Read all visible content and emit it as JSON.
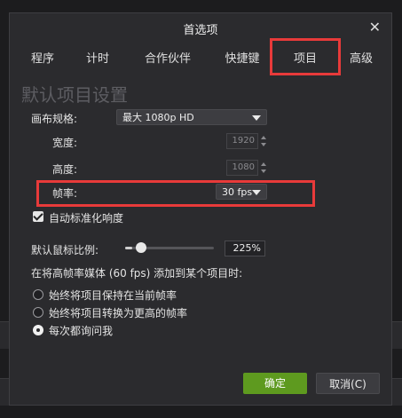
{
  "dialog": {
    "title": "首选项"
  },
  "tabs": [
    {
      "label": "程序"
    },
    {
      "label": "计时"
    },
    {
      "label": "合作伙伴"
    },
    {
      "label": "快捷键"
    },
    {
      "label": "项目",
      "active": true
    },
    {
      "label": "高级"
    }
  ],
  "section": {
    "title": "默认项目设置"
  },
  "canvas": {
    "label": "画布规格:",
    "value": "最大 1080p HD"
  },
  "width": {
    "label": "宽度:",
    "value": "1920"
  },
  "height": {
    "label": "高度:",
    "value": "1080"
  },
  "framerate": {
    "label": "帧率:",
    "value": "30 fps"
  },
  "auto_normalize": {
    "label": "自动标准化响度",
    "checked": true
  },
  "cursor_scale": {
    "label": "默认鼠标比例:",
    "value": "225%",
    "slider_fraction": 0.08
  },
  "high_fps": {
    "label": "在将高帧率媒体 (60 fps) 添加到某个项目时:",
    "options": [
      {
        "label": "始终将项目保持在当前帧率",
        "selected": false
      },
      {
        "label": "始终将项目转换为更高的帧率",
        "selected": false
      },
      {
        "label": "每次都询问我",
        "selected": true
      }
    ]
  },
  "buttons": {
    "ok": "确定",
    "cancel": "取消(C)"
  },
  "colors": {
    "highlight": "#e83a3a",
    "ok_button": "#5e9a1f"
  }
}
